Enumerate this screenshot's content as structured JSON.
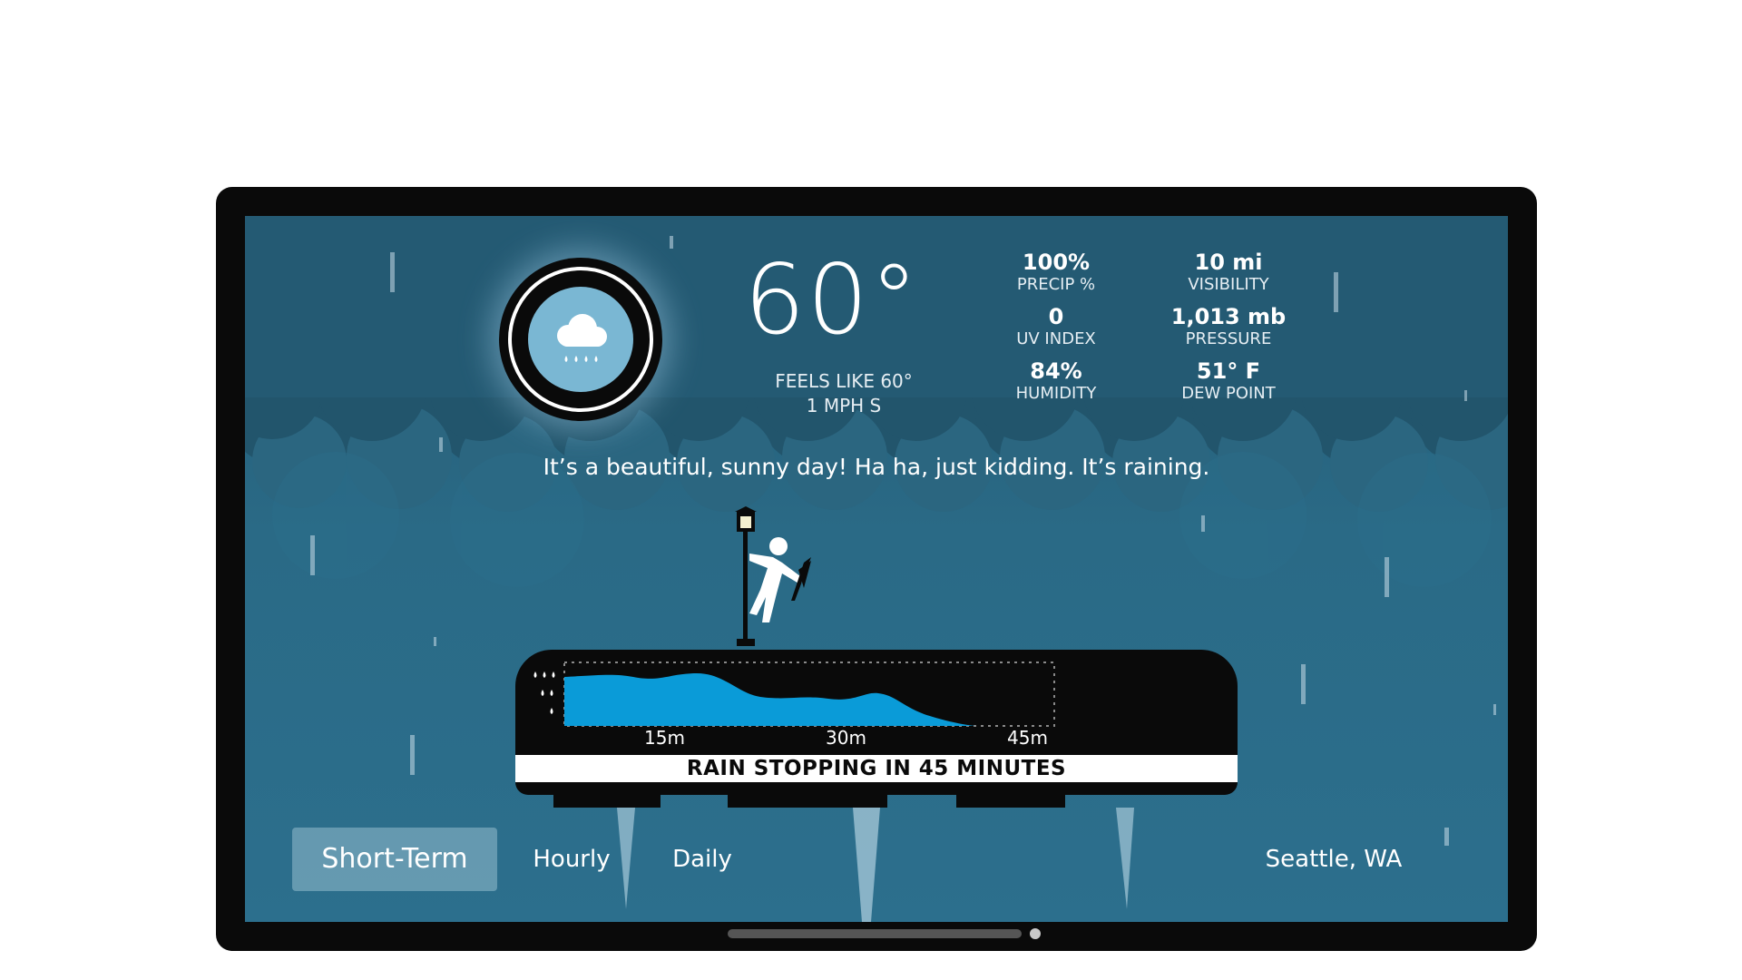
{
  "current": {
    "temperature": "60°",
    "feels_like": "FEELS LIKE 60°",
    "wind": "1 MPH S",
    "condition_icon": "rain-cloud-icon"
  },
  "stats": [
    {
      "value": "100%",
      "label": "PRECIP %"
    },
    {
      "value": "10 mi",
      "label": "VISIBILITY"
    },
    {
      "value": "0",
      "label": "UV INDEX"
    },
    {
      "value": "1,013 mb",
      "label": "PRESSURE"
    },
    {
      "value": "84%",
      "label": "HUMIDITY"
    },
    {
      "value": "51° F",
      "label": "DEW POINT"
    }
  ],
  "tagline": "It’s a beautiful, sunny day! Ha ha, just kidding. It’s raining.",
  "precip_timeline": {
    "ticks": [
      "15m",
      "30m",
      "45m"
    ],
    "banner": "RAIN STOPPING IN 45 MINUTES",
    "intensity_icon": "raindrops-icon",
    "fill_color": "#0a9bd8"
  },
  "nav": {
    "tabs": [
      {
        "label": "Short-Term",
        "active": true
      },
      {
        "label": "Hourly",
        "active": false
      },
      {
        "label": "Daily",
        "active": false
      }
    ],
    "location": "Seattle, WA"
  },
  "colors": {
    "background": "#2a6a86",
    "accent": "#0a9bd8",
    "frame": "#0a0a0a"
  }
}
